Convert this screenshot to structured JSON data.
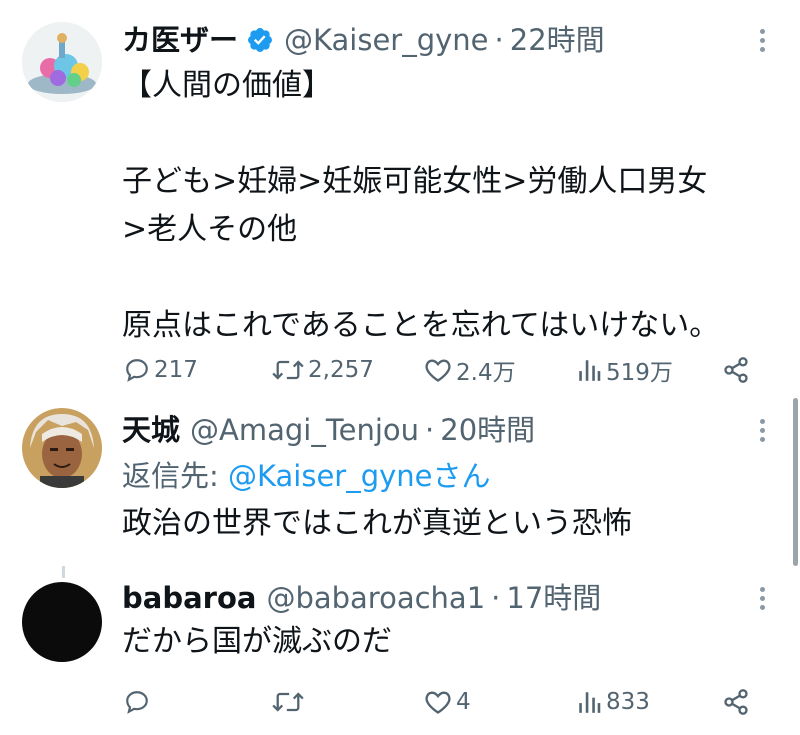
{
  "tweets": [
    {
      "name": "カ医ザー",
      "handle": "@Kaiser_gyne",
      "dot": "·",
      "time": "22時間",
      "verified": true,
      "text": "【人間の価値】\n\n子ども>妊婦>妊娠可能女性>労働人口男女\n>老人その他\n\n原点はこれであることを忘れてはいけない。",
      "actions": {
        "replies": "217",
        "retweets": "2,257",
        "likes": "2.4万",
        "views": "519万"
      }
    },
    {
      "name": "天城",
      "handle": "@Amagi_Tenjou",
      "dot": "·",
      "time": "20時間",
      "reply_prefix": "返信先: ",
      "reply_mention": "@Kaiser_gyneさん",
      "text": "政治の世界ではこれが真逆という恐怖"
    },
    {
      "name": "babaroa",
      "handle": "@babaroacha1",
      "dot": "·",
      "time": "17時間",
      "text": "だから国が滅ぶのだ",
      "actions": {
        "replies": "",
        "retweets": "",
        "likes": "4",
        "views": "833"
      }
    }
  ],
  "colors": {
    "text": "#0f1419",
    "secondary": "#536471",
    "link": "#1d9bf0",
    "verified": "#1d9bf0"
  },
  "icons": {
    "reply": "speech-bubble-icon",
    "retweet": "retweet-arrows-icon",
    "like": "heart-icon",
    "views": "bar-chart-icon",
    "share": "share-nodes-icon",
    "more": "three-dots-vertical-icon",
    "verified": "verified-badge-icon"
  }
}
